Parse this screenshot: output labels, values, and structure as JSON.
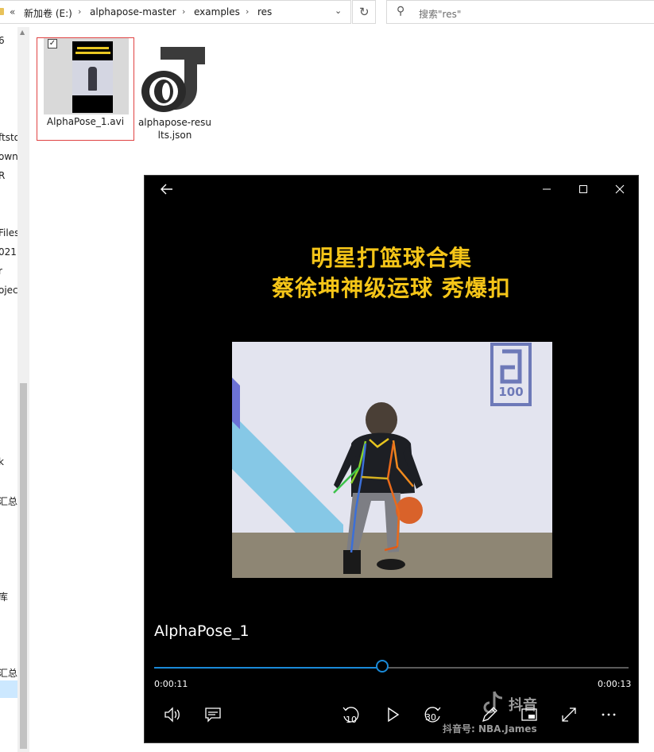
{
  "explorer": {
    "breadcrumb": [
      "新加卷 (E:)",
      "alphapose-master",
      "examples",
      "res"
    ],
    "back_chevron": "«",
    "separator": "›",
    "search_placeholder": "搜索\"res\"",
    "nav_items": [
      "6",
      "ftsto",
      "own",
      "R",
      "Files",
      "021",
      "r",
      "oject",
      "k",
      "汇总",
      "库",
      "汇总"
    ],
    "files": [
      {
        "name": "AlphaPose_1.avi",
        "selected": true,
        "checked": true
      },
      {
        "name_line1": "alphapose-resu",
        "name_line2": "lts.json"
      }
    ]
  },
  "player": {
    "caption_line1": "明星打篮球合集",
    "caption_line2": "蔡徐坤神级运球 秀爆扣",
    "title": "AlphaPose_1",
    "current_time": "0:00:11",
    "end_time": "0:00:13",
    "progress_fraction": 0.48,
    "skip_back_label": "10",
    "skip_forward_label": "30",
    "watermark_brand": "抖音",
    "watermark_id": "抖音号: NBA.James",
    "icons": [
      "back-arrow-icon",
      "minimize-icon",
      "maximize-icon",
      "close-icon",
      "volume-icon",
      "captions-icon",
      "skip-back-10-icon",
      "play-icon",
      "skip-forward-30-icon",
      "edit-pen-icon",
      "mini-view-icon",
      "fullscreen-icon",
      "more-icon"
    ]
  },
  "colors": {
    "accent": "#1a8ad8",
    "caption_yellow": "#f5c518",
    "selection_border": "#e04343"
  }
}
